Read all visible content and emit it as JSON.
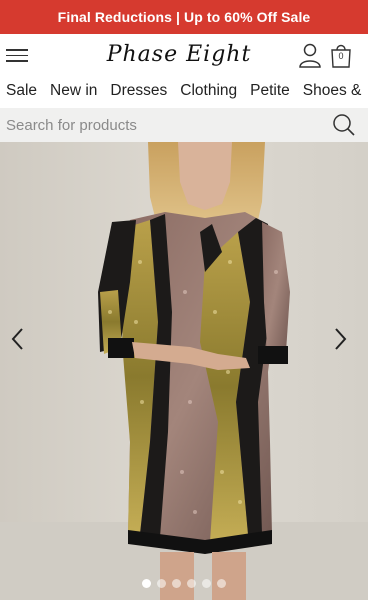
{
  "promo": {
    "text": "Final Reductions | Up to 60% Off Sale"
  },
  "header": {
    "logo_text": "Phase Eight",
    "bag_count": "0"
  },
  "nav": {
    "items": [
      "Sale",
      "New in",
      "Dresses",
      "Clothing",
      "Petite",
      "Shoes &"
    ]
  },
  "search": {
    "placeholder": "Search for products"
  },
  "carousel": {
    "slide_count": 6,
    "active_index": 0
  },
  "colors": {
    "promo_bg": "#d63a2f",
    "search_bg": "#f0f0ef",
    "hero_bg": "#d9d6cf"
  }
}
